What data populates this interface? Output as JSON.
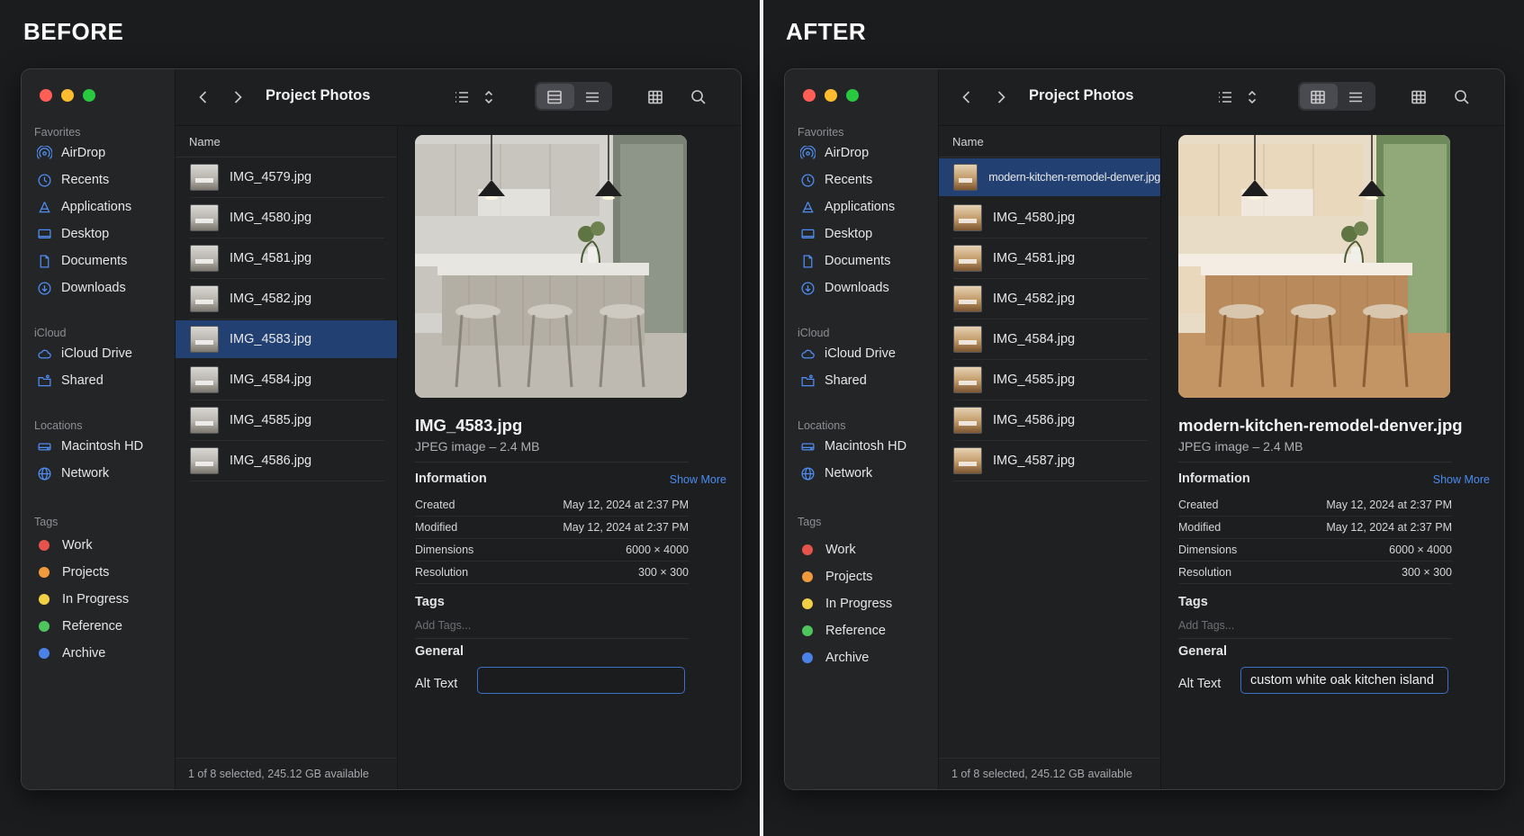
{
  "panels": {
    "before": {
      "label": "BEFORE",
      "window": {
        "title": "Project Photos",
        "sidebar": {
          "favorites_title": "Favorites",
          "favorites": [
            "AirDrop",
            "Recents",
            "Applications",
            "Desktop",
            "Documents",
            "Downloads"
          ],
          "icloud_title": "iCloud",
          "icloud": [
            "iCloud Drive",
            "Shared"
          ],
          "locations_title": "Locations",
          "locations": [
            "Macintosh HD",
            "Network"
          ],
          "tags_title": "Tags",
          "tags": [
            {
              "label": "Work",
              "color": "#e5534b"
            },
            {
              "label": "Projects",
              "color": "#ef9a3c"
            },
            {
              "label": "In Progress",
              "color": "#f2d046"
            },
            {
              "label": "Reference",
              "color": "#4ec45c"
            },
            {
              "label": "Archive",
              "color": "#4b82e8"
            }
          ]
        },
        "list_header": "Name",
        "files": [
          "IMG_4579.jpg",
          "IMG_4580.jpg",
          "IMG_4581.jpg",
          "IMG_4582.jpg",
          "IMG_4583.jpg",
          "IMG_4584.jpg",
          "IMG_4585.jpg",
          "IMG_4586.jpg"
        ],
        "selected_file": "IMG_4583.jpg",
        "status": "1 of 8 selected, 245.12 GB available",
        "preview": {
          "name": "IMG_4583.jpg",
          "kind": "JPEG image – 2.4 MB",
          "information_title": "Information",
          "show_more": "Show More",
          "info": [
            {
              "key": "Created",
              "value": "May 12, 2024 at 2:37 PM"
            },
            {
              "key": "Modified",
              "value": "May 12, 2024 at 2:37 PM"
            },
            {
              "key": "Dimensions",
              "value": "6000 × 4000"
            },
            {
              "key": "Resolution",
              "value": "300 × 300"
            }
          ],
          "tags_title": "Tags",
          "tags_placeholder": "Add Tags...",
          "general_title": "General",
          "alt_label": "Alt Text",
          "alt_value": ""
        }
      }
    },
    "after": {
      "label": "AFTER",
      "window": {
        "title": "Project Photos",
        "sidebar": {
          "favorites_title": "Favorites",
          "favorites": [
            "AirDrop",
            "Recents",
            "Applications",
            "Desktop",
            "Documents",
            "Downloads"
          ],
          "icloud_title": "iCloud",
          "icloud": [
            "iCloud Drive",
            "Shared"
          ],
          "locations_title": "Locations",
          "locations": [
            "Macintosh HD",
            "Network"
          ],
          "tags_title": "Tags",
          "tags": [
            {
              "label": "Work",
              "color": "#e5534b"
            },
            {
              "label": "Projects",
              "color": "#ef9a3c"
            },
            {
              "label": "In Progress",
              "color": "#f2d046"
            },
            {
              "label": "Reference",
              "color": "#4ec45c"
            },
            {
              "label": "Archive",
              "color": "#4b82e8"
            }
          ]
        },
        "list_header": "Name",
        "files": [
          "modern-kitchen-remodel-denver.jpg",
          "IMG_4580.jpg",
          "IMG_4581.jpg",
          "IMG_4582.jpg",
          "IMG_4584.jpg",
          "IMG_4585.jpg",
          "IMG_4586.jpg",
          "IMG_4587.jpg"
        ],
        "selected_file": "modern-kitchen-remodel-denver.jpg",
        "status": "1 of 8 selected, 245.12 GB available",
        "preview": {
          "name": "modern-kitchen-remodel-denver.jpg",
          "kind": "JPEG image – 2.4 MB",
          "information_title": "Information",
          "show_more": "Show More",
          "info": [
            {
              "key": "Created",
              "value": "May 12, 2024 at 2:37 PM"
            },
            {
              "key": "Modified",
              "value": "May 12, 2024 at 2:37 PM"
            },
            {
              "key": "Dimensions",
              "value": "6000 × 4000"
            },
            {
              "key": "Resolution",
              "value": "300 × 300"
            }
          ],
          "tags_title": "Tags",
          "tags_placeholder": "Add Tags...",
          "general_title": "General",
          "alt_label": "Alt Text",
          "alt_value": "custom white oak kitchen island"
        }
      }
    }
  },
  "icons": {
    "sidebar": [
      "airdrop-icon",
      "clock-icon",
      "applications-icon",
      "desktop-icon",
      "document-icon",
      "download-icon",
      "cloud-icon",
      "shared-folder-icon",
      "disk-icon",
      "globe-icon"
    ],
    "toolbar": [
      "chevron-left-icon",
      "chevron-right-icon",
      "list-view-icon",
      "sort-icon",
      "gallery-view-icon",
      "menu-icon",
      "grid-icon",
      "search-icon"
    ]
  },
  "colors": {
    "accent": "#4b8bf0",
    "selection": "#234072",
    "window_bg": "#1e1f21",
    "backdrop": "#1b1c1e"
  }
}
